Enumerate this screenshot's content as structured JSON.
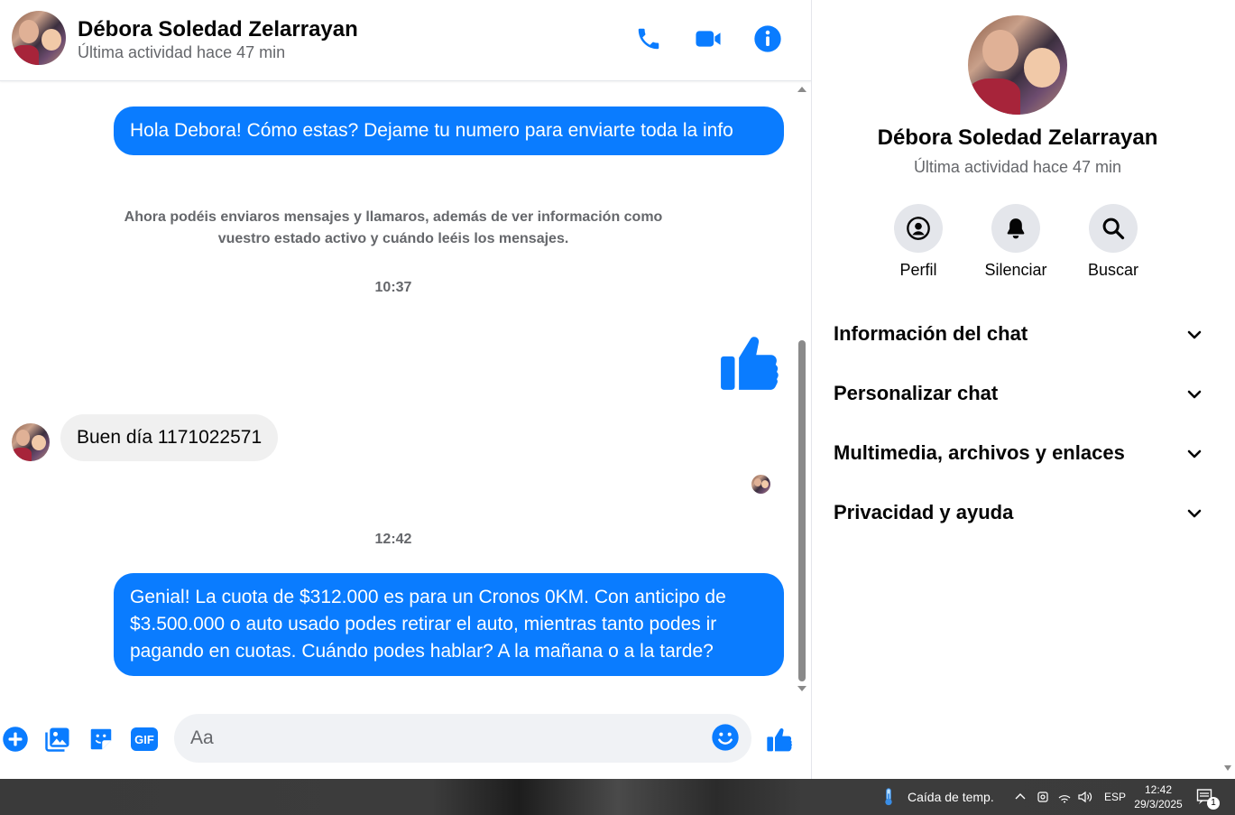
{
  "contact": {
    "name": "Débora Soledad Zelarrayan",
    "status": "Última actividad hace 47 min"
  },
  "header": {
    "call_icon": "phone-icon",
    "video_icon": "video-camera-icon",
    "info_icon": "info-icon"
  },
  "messages": {
    "msg1": "Hola Debora! Cómo estas? Dejame tu numero para enviarte toda la info",
    "system_note": "Ahora podéis enviaros mensajes y llamaros, además de ver información como vuestro estado activo y cuándo leéis los mensajes.",
    "time1": "10:37",
    "reaction": "thumbs-up-icon",
    "msg_in": "Buen día 1171022571",
    "time2": "12:42",
    "msg2": "Genial! La cuota de $312.000 es para un Cronos 0KM. Con anticipo de $3.500.000 o auto usado podes retirar el auto, mientras tanto podes ir pagando en cuotas. Cuándo podes hablar? A la mañana o a la tarde?"
  },
  "composer": {
    "placeholder": "Aa",
    "icons": [
      "plus-icon",
      "image-icon",
      "sticker-icon",
      "gif-icon",
      "emoji-icon",
      "thumbs-up-icon"
    ],
    "gif_label": "GIF"
  },
  "info_panel": {
    "actions": [
      {
        "label": "Perfil",
        "icon": "profile-icon"
      },
      {
        "label": "Silenciar",
        "icon": "bell-icon"
      },
      {
        "label": "Buscar",
        "icon": "search-icon"
      }
    ],
    "sections": [
      {
        "title": "Información del chat"
      },
      {
        "title": "Personalizar chat"
      },
      {
        "title": "Multimedia, archivos y enlaces"
      },
      {
        "title": "Privacidad y ayuda"
      }
    ]
  },
  "taskbar": {
    "weather": "Caída de temp.",
    "language": "ESP",
    "time": "12:42",
    "date": "29/3/2025",
    "notifications": "1"
  },
  "colors": {
    "accent": "#0a7cff",
    "bubble_in": "#f0f0f0",
    "muted_text": "#65676b"
  }
}
